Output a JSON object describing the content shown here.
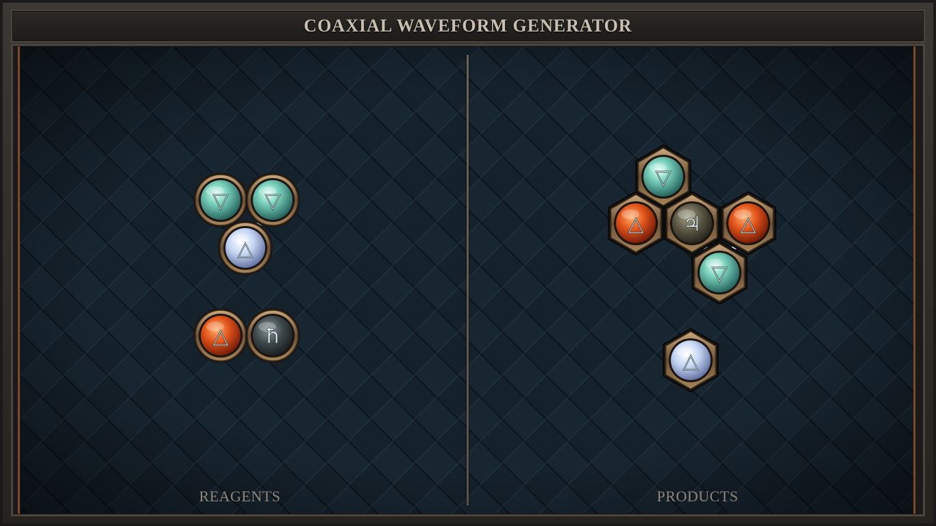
{
  "title": "COAXIAL WAVEFORM GENERATOR",
  "panels": {
    "left_label": "REAGENTS",
    "right_label": "PRODUCTS"
  },
  "colors": {
    "salt": "#8fd4c0",
    "fire": "#e2541a",
    "air": "#c8d8f5",
    "lead": "#4a5456",
    "tin": "#6e6a58",
    "bond": "#b9c4cc"
  },
  "symbols": {
    "salt": "▽",
    "fire": "△",
    "air": "△",
    "lead": "ħ",
    "tin": "♃"
  },
  "reagents": [
    {
      "element": "salt",
      "icon": "water-triangle-icon"
    },
    {
      "element": "salt",
      "icon": "water-triangle-icon"
    },
    {
      "element": "air",
      "icon": "air-triangle-icon"
    },
    {
      "element": "fire",
      "icon": "fire-triangle-icon"
    },
    {
      "element": "lead",
      "icon": "lead-symbol-icon"
    }
  ],
  "products": [
    {
      "element": "salt",
      "icon": "water-triangle-icon"
    },
    {
      "element": "fire",
      "icon": "fire-triangle-icon"
    },
    {
      "element": "tin",
      "icon": "tin-symbol-icon"
    },
    {
      "element": "fire",
      "icon": "fire-triangle-icon"
    },
    {
      "element": "salt",
      "icon": "water-triangle-icon"
    },
    {
      "element": "air",
      "icon": "air-triangle-icon"
    }
  ]
}
